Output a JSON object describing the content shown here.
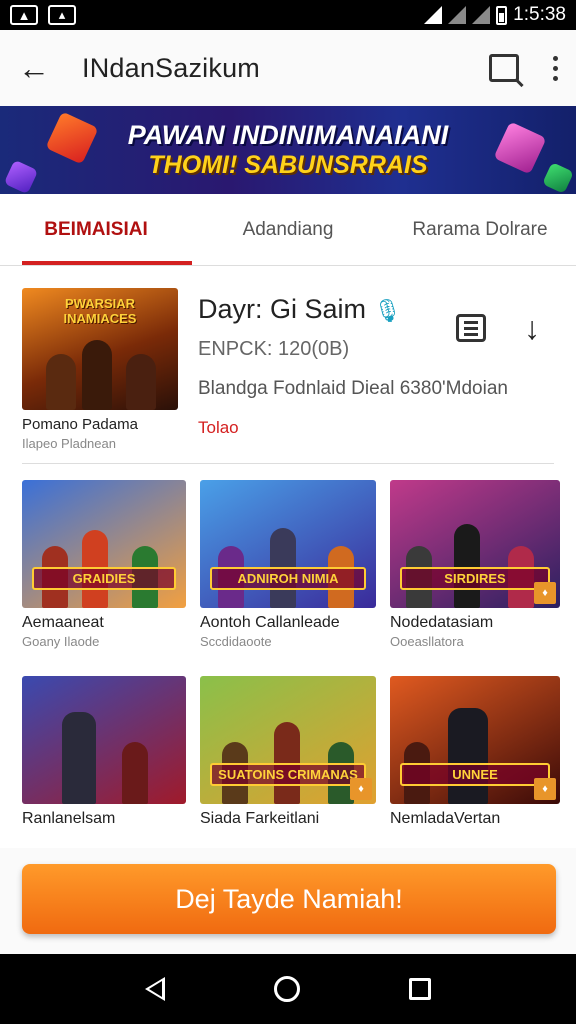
{
  "app": {
    "title": "INdanSazikum"
  },
  "banner": {
    "line1": "PAWAN INDINIMANAIANI",
    "line2": "THOMI! SABUNSRRAIS"
  },
  "tabs": [
    {
      "label": "BEIMAISIAI",
      "active": true
    },
    {
      "label": "Adandiang",
      "active": false
    },
    {
      "label": "Rarama Dolrare",
      "active": false
    }
  ],
  "featured": {
    "thumb_text": "PWARSIAR INAMIACES",
    "name": "Pomano Padama",
    "sub": "Ilapeo Pladnean",
    "title": "Dayr: Gi Saim",
    "meta": "ENPCK: 120(0B)",
    "desc": "Blandga Fodnlaid Dieal  6380'Mdoian",
    "price": "Tolao"
  },
  "grid": [
    {
      "name": "Aemaaneat",
      "sub": "Goany Ilaode",
      "logo": "GRAIDIES",
      "colors": [
        "#3a70d8",
        "#f2a040"
      ]
    },
    {
      "name": "Aontoh Callanleade",
      "sub": "Sccdidaoote",
      "logo": "ADNIROH NIMIA",
      "colors": [
        "#4aa0e8",
        "#3a2a9a"
      ]
    },
    {
      "name": "Nodedatasiam",
      "sub": "Ooeasllatora",
      "logo": "SIRDIRES",
      "colors": [
        "#c03a8a",
        "#2a2060"
      ]
    },
    {
      "name": "Ranlanelsam",
      "sub": "",
      "logo": "",
      "colors": [
        "#3a4ab0",
        "#a01a2a"
      ]
    },
    {
      "name": "Siada Farkeitlani",
      "sub": "",
      "logo": "SUATOINS CRIMANAS",
      "colors": [
        "#8ac04a",
        "#e0a030"
      ]
    },
    {
      "name": "NemladaVertan",
      "sub": "",
      "logo": "UNNEE",
      "colors": [
        "#e05a20",
        "#3a0a08"
      ]
    }
  ],
  "cta": {
    "label": "Dej Tayde Namiah!"
  },
  "status": {
    "time": "1:5:38"
  },
  "icons": [
    "back-arrow-icon",
    "search-icon",
    "more-vert-icon",
    "mic-icon",
    "list-icon",
    "download-icon",
    "nav-back-icon",
    "nav-home-icon",
    "nav-recents-icon"
  ]
}
